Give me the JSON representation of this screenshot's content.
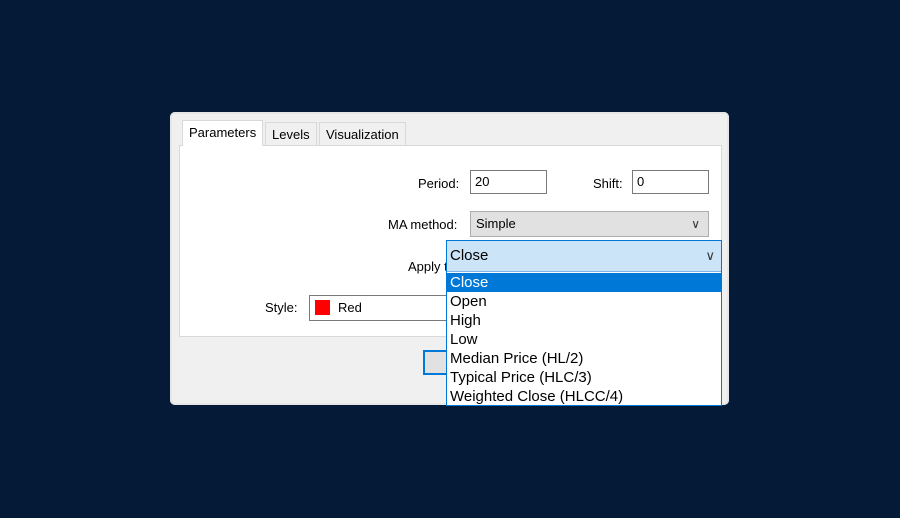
{
  "tabs": [
    {
      "label": "Parameters"
    },
    {
      "label": "Levels"
    },
    {
      "label": "Visualization"
    }
  ],
  "params": {
    "period_label": "Period:",
    "period_value": "20",
    "shift_label": "Shift:",
    "shift_value": "0",
    "ma_method_label": "MA method:",
    "ma_method_value": "Simple",
    "apply_label": "Apply t",
    "style_label": "Style:",
    "style_value": "Red",
    "style_color": "#ff0000"
  },
  "apply_dropdown": {
    "selected": "Close",
    "options": [
      "Close",
      "Open",
      "High",
      "Low",
      "Median Price (HL/2)",
      "Typical Price (HLC/3)",
      "Weighted Close (HLCC/4)"
    ],
    "highlight_color": "#0078d7"
  }
}
